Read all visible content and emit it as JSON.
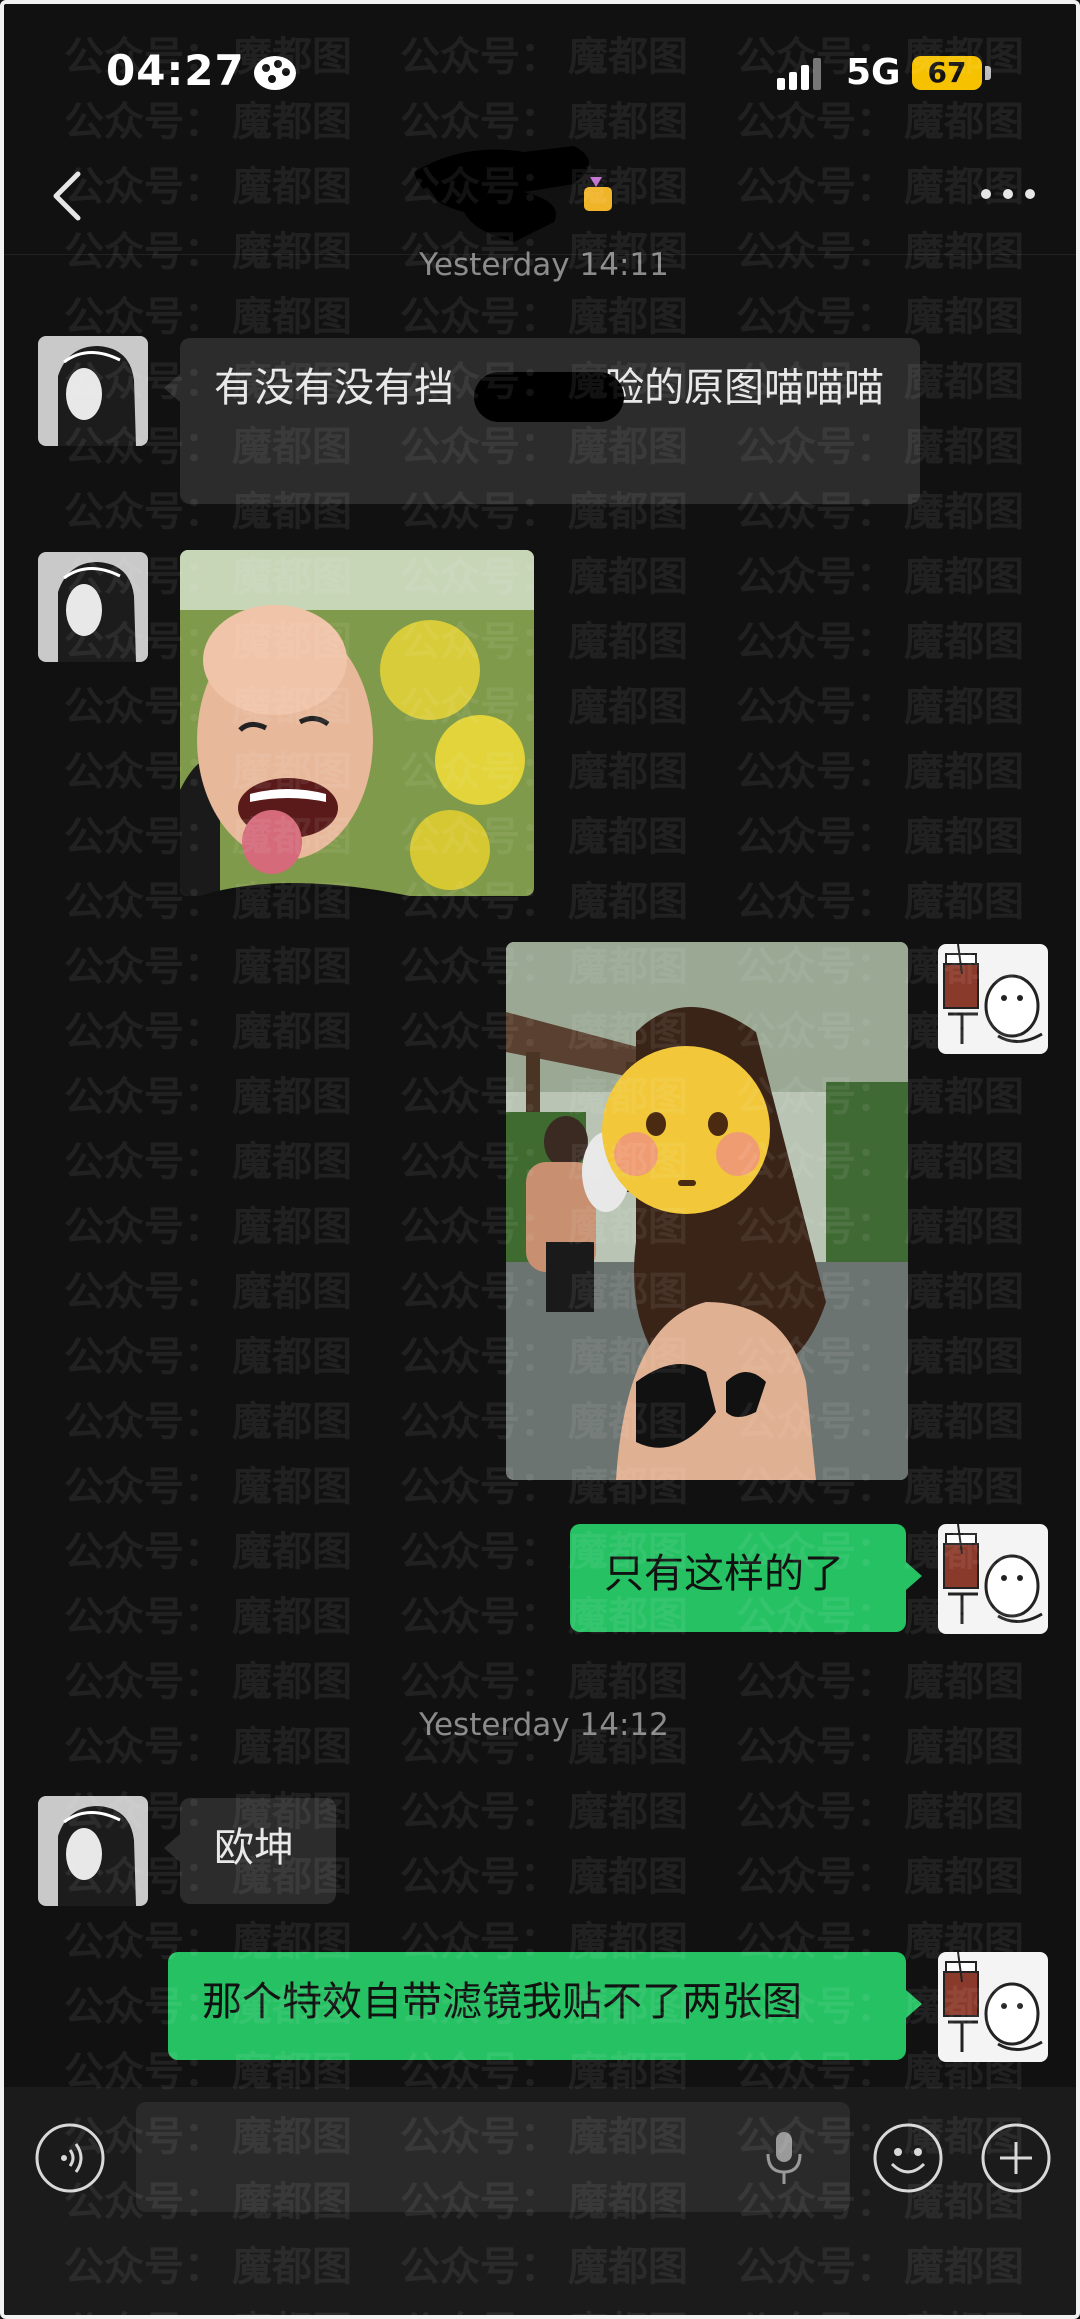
{
  "status_bar": {
    "time": "04:27",
    "network": "5G",
    "battery": "67"
  },
  "chat": {
    "timestamps": [
      "Yesterday 14:11",
      "Yesterday 14:12"
    ],
    "messages": [
      {
        "from": "contact",
        "type": "text",
        "text_part1": "有没有没有挡",
        "text_part2": "脸的原图喵喵喵"
      },
      {
        "from": "contact",
        "type": "image"
      },
      {
        "from": "me",
        "type": "image"
      },
      {
        "from": "me",
        "type": "text",
        "text": "只有这样的了"
      },
      {
        "from": "contact",
        "type": "text",
        "text": "欧坤"
      },
      {
        "from": "me",
        "type": "text",
        "text": "那个特效自带滤镜我贴不了两张图"
      }
    ]
  },
  "icons": {
    "back": "back-chevron-icon",
    "more": "more-dots-icon",
    "voice": "voice-icon",
    "mic": "mic-icon",
    "emoji": "emoji-icon",
    "plus": "plus-icon"
  },
  "watermark": {
    "text_a": "公众号：",
    "text_b": "魔都图"
  },
  "colors": {
    "background": "#111111",
    "incoming_bubble": "#2c2c2c",
    "outgoing_bubble": "#25c163",
    "battery": "#f6c200"
  }
}
